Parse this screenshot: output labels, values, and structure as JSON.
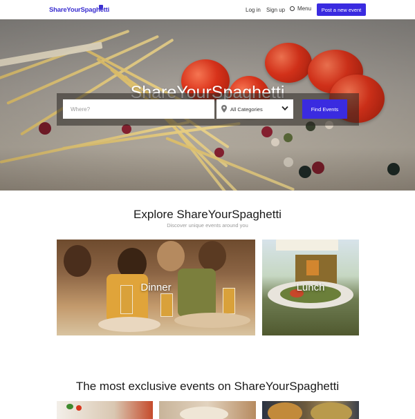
{
  "header": {
    "logo": "ShareYourSpaghetti",
    "login": "Log in",
    "signup": "Sign up",
    "menu": "Menu",
    "post_button": "Post a new event"
  },
  "hero": {
    "title": "ShareYourSpaghetti",
    "search": {
      "where_placeholder": "Where?",
      "category": "All Categories",
      "find_button": "Find Events"
    }
  },
  "explore": {
    "title": "Explore ShareYourSpaghetti",
    "subtitle": "Discover unique events around you",
    "cards": [
      {
        "label": "Dinner"
      },
      {
        "label": "Lunch"
      }
    ]
  },
  "exclusive": {
    "title": "The most exclusive events on ShareYourSpaghetti"
  },
  "colors": {
    "brand": "#3a2be0",
    "logo": "#3b2fd0"
  },
  "icons": {
    "menu": "menu-circle-icon",
    "location": "location-pin-icon",
    "dropdown": "chevron-down-icon",
    "logo_mark": "chef-hat-icon"
  }
}
